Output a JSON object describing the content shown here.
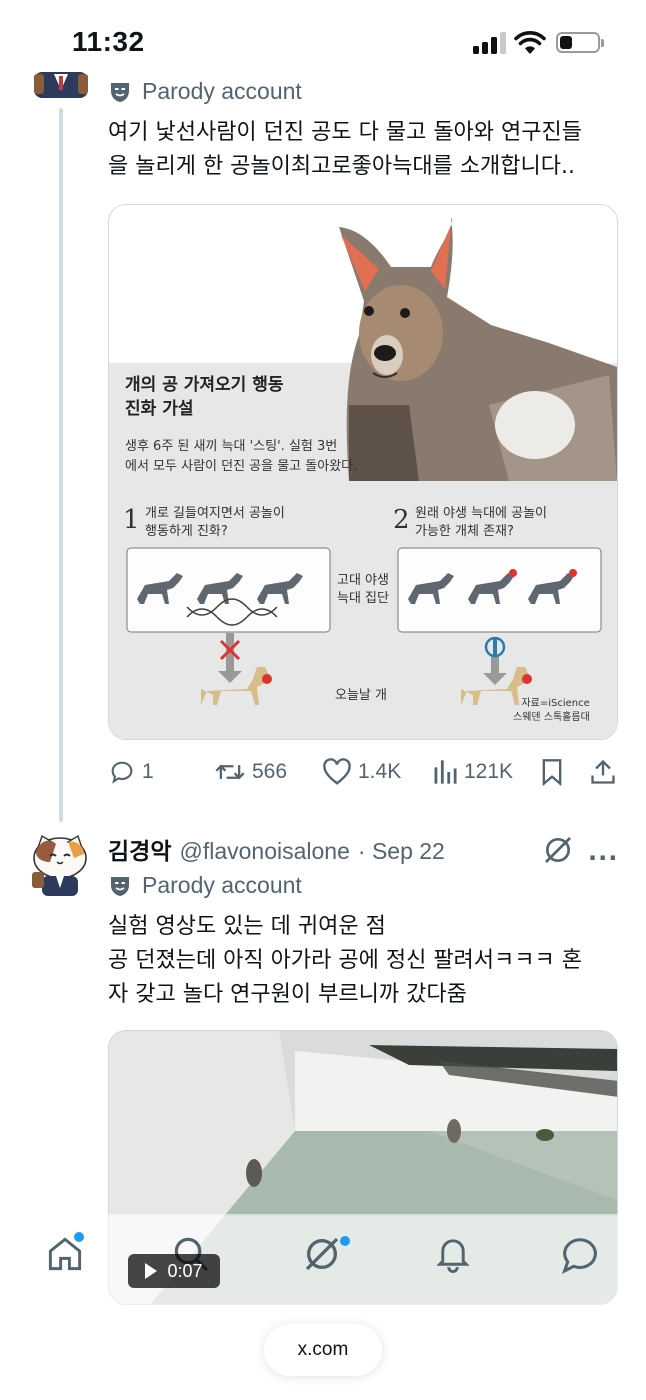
{
  "status_bar": {
    "time": "11:32"
  },
  "tweet1": {
    "badge": "Parody account",
    "text_lines": [
      "여기 낯선사람이 던진 공도 다 물고 돌아와 연구진들",
      "을 놀리게 한 공놀이최고로좋아늑대를 소개합니다.."
    ],
    "image": {
      "title_lines": [
        "개의 공 가져오기 행동",
        "진화 가설"
      ],
      "subtitle_lines": [
        "생후 6주 된 새끼 늑대 '스팅'. 실험 3번",
        "에서 모두 사람이 던진 공을 물고 돌아왔다."
      ],
      "hypothesis1": {
        "num": "1",
        "lines": [
          "개로 길들여지면서 공놀이",
          "행동하게 진화?"
        ]
      },
      "hypothesis2": {
        "num": "2",
        "lines": [
          "원래 야생 늑대에 공놀이",
          "가능한 개체 존재?"
        ]
      },
      "middle_label_lines": [
        "고대 야생",
        "늑대 집단"
      ],
      "bottom_label": "오늘날 개",
      "source_lines": [
        "자료=iScience",
        "스웨덴 스톡홀름대"
      ]
    },
    "actions": {
      "replies": "1",
      "reposts": "566",
      "likes": "1.4K",
      "views": "121K"
    }
  },
  "tweet2": {
    "display_name": "김경악",
    "handle": "@flavonoisalone",
    "date": "· Sep 22",
    "more": "···",
    "badge": "Parody account",
    "text_lines": [
      "실험 영상도 있는 데 귀여운 점",
      "공 던졌는데 아직 아가라 공에 정신 팔려서ㅋㅋㅋ 혼",
      "자 갖고 놀다 연구원이 부르니까 갔다줌"
    ],
    "video_time": "0:07"
  },
  "bottom_nav": [
    "home-icon",
    "search-icon",
    "grok-icon",
    "notifications-icon",
    "messages-icon"
  ],
  "browser": {
    "url": "x.com"
  },
  "colors": {
    "accent": "#1d9bf0",
    "text": "#0f1419",
    "secondary": "#536471",
    "like": "#536471"
  }
}
